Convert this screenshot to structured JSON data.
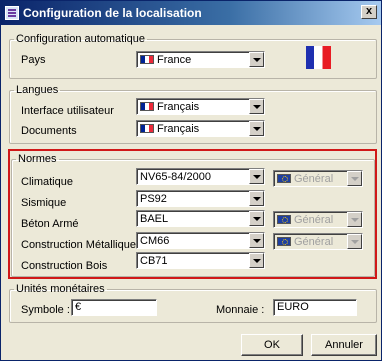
{
  "window": {
    "title": "Configuration de la localisation",
    "close_label": "x"
  },
  "auto": {
    "legend": "Configuration automatique",
    "pays_label": "Pays",
    "pays_value": "France",
    "pays_flag": "flag-france-icon"
  },
  "langues": {
    "legend": "Langues",
    "ui_label": "Interface utilisateur",
    "ui_value": "Français",
    "docs_label": "Documents",
    "docs_value": "Français"
  },
  "normes": {
    "legend": "Normes",
    "climatique_label": "Climatique",
    "climatique_value": "NV65-84/2000",
    "climatique_scope": "Général",
    "sismique_label": "Sismique",
    "sismique_value": "PS92",
    "beton_label": "Béton Armé",
    "beton_value": "BAEL",
    "beton_scope": "Général",
    "metal_label": "Construction Métallique",
    "metal_value": "CM66",
    "metal_scope": "Général",
    "bois_label": "Construction Bois",
    "bois_value": "CB71"
  },
  "monnaie": {
    "legend": "Unités monétaires",
    "symbole_label": "Symbole :",
    "symbole_value": "€",
    "monnaie_label": "Monnaie :",
    "monnaie_value": "EURO"
  },
  "buttons": {
    "ok": "OK",
    "cancel": "Annuler"
  },
  "colors": {
    "highlight": "#d01818",
    "title_bar": "#0a246a"
  }
}
